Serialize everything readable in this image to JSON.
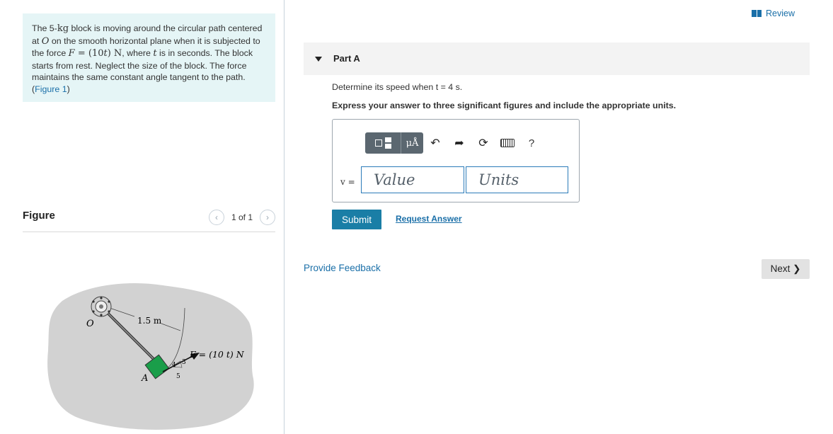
{
  "problem": {
    "t1": "The 5-",
    "mass_unit": "kg",
    "t2": " block is moving around the circular path centered at ",
    "point_o": "O",
    "t3": " on the smooth horizontal plane when it is subjected to the force ",
    "f_sym": "F",
    "f_eq": " = (10",
    "t_sym": "t",
    "f_close": ") N",
    "t4": ", where ",
    "t5": " is in seconds. The block starts from rest. Neglect the size of the block. The force maintains the same constant angle tangent to the path. (",
    "figure_link": "Figure 1",
    "t6": ")"
  },
  "figure": {
    "title": "Figure",
    "pager": "1 of 1",
    "prev_icon": "chevron-left-icon",
    "next_icon": "chevron-right-icon",
    "label_radius": "1.5 m",
    "label_o": "O",
    "label_a": "A",
    "label_force": "F = (10 t) N",
    "slope_4": "4",
    "slope_3": "3",
    "slope_5": "5",
    "colors": {
      "plane": "#d2d2d2",
      "block": "#1a9e4a"
    }
  },
  "review": {
    "label": "Review",
    "icon": "book-icon"
  },
  "part": {
    "title": "Part A",
    "caret_icon": "caret-down-icon"
  },
  "question": "Determine its speed when t = 4 s.",
  "instruction": "Express your answer to three significant figures and include the appropriate units.",
  "toolbar": {
    "units_label": "μÅ",
    "undo_icon": "undo-icon",
    "redo_icon": "redo-icon",
    "reset_icon": "reset-icon",
    "keyboard_icon": "keyboard-icon",
    "help_label": "?"
  },
  "answer": {
    "var_label": "v =",
    "value_placeholder": "Value",
    "units_placeholder": "Units"
  },
  "submit_label": "Submit",
  "request_label": "Request Answer",
  "feedback_label": "Provide Feedback",
  "next_label": "Next"
}
